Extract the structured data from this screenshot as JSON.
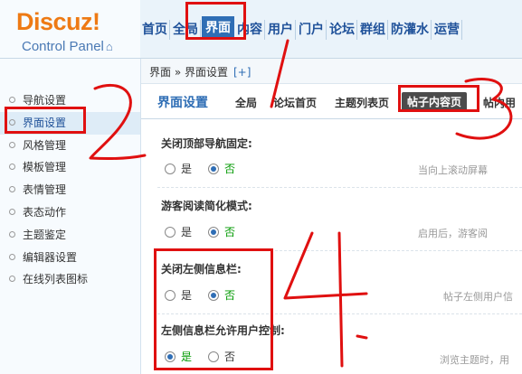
{
  "logo": {
    "brand": "Discuz!",
    "subtitle": "Control Panel"
  },
  "topnav": {
    "items": [
      "首页",
      "全局",
      "界面",
      "内容",
      "用户",
      "门户",
      "论坛",
      "群组",
      "防灌水",
      "运营"
    ],
    "active": "界面"
  },
  "breadcrumb": {
    "path": "界面 » 界面设置",
    "plus": "[+]"
  },
  "sidebar": {
    "items": [
      "导航设置",
      "界面设置",
      "风格管理",
      "模板管理",
      "表情管理",
      "表态动作",
      "主题鉴定",
      "编辑器设置",
      "在线列表图标"
    ],
    "active": "界面设置"
  },
  "main": {
    "title": "界面设置",
    "tabs": [
      "全局",
      "论坛首页",
      "主题列表页",
      "帖子内容页",
      "帖内用"
    ],
    "active_tab": "帖子内容页",
    "settings": [
      {
        "title": "关闭顶部导航固定:",
        "yes": "是",
        "no": "否",
        "selected": "no",
        "tip": "当向上滚动屏幕"
      },
      {
        "title": "游客阅读简化模式:",
        "yes": "是",
        "no": "否",
        "selected": "no",
        "tip": "启用后，游客阅"
      },
      {
        "title": "关闭左侧信息栏:",
        "yes": "是",
        "no": "否",
        "selected": "no",
        "tip": "帖子左侧用户信"
      },
      {
        "title": "左侧信息栏允许用户控制:",
        "yes": "是",
        "no": "否",
        "selected": "yes",
        "tip": "浏览主题时，用"
      }
    ]
  },
  "annotations": {
    "color": "#e01010",
    "numbers": [
      "1",
      "2",
      "3",
      "4."
    ]
  },
  "colors": {
    "brand_orange": "#ee7a14",
    "nav_blue": "#20529a",
    "active_blue": "#2f6eb5",
    "tab_dark": "#4b4b4b"
  }
}
